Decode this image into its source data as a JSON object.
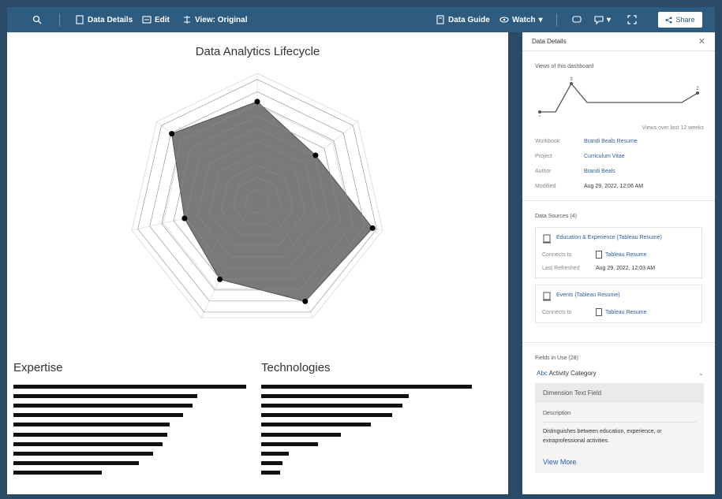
{
  "toolbar": {
    "data_details": "Data Details",
    "edit": "Edit",
    "view_original": "View: Original",
    "data_guide": "Data Guide",
    "watch": "Watch",
    "share": "Share"
  },
  "canvas": {
    "expertise_title": "Expertise",
    "technologies_title": "Technologies"
  },
  "chart_data": [
    {
      "type": "radar",
      "title": "Data Analytics Lifecycle",
      "axes": 7,
      "rings": 4,
      "values": [
        0.78,
        0.58,
        0.92,
        0.86,
        0.67,
        0.58,
        0.85
      ],
      "fill": "#7a7a7a",
      "point_color": "#000000"
    },
    {
      "type": "bar",
      "orientation": "horizontal",
      "title": "Expertise",
      "values": [
        100,
        79,
        77,
        73,
        67,
        66,
        64,
        60,
        54,
        38
      ]
    },
    {
      "type": "bar",
      "orientation": "horizontal",
      "title": "Technologies",
      "values": [
        100,
        70,
        67,
        62,
        52,
        38,
        27,
        13,
        10,
        9
      ]
    }
  ],
  "panel": {
    "title": "Data Details",
    "views_label": "Views of this dashboard",
    "views_chart": [
      0,
      0,
      3,
      1,
      1,
      1,
      1,
      1,
      1,
      1,
      2
    ],
    "views_caption": "Views over last 12 weeks",
    "meta": [
      {
        "k": "Workbook",
        "v": "Brandi Beals Resume",
        "link": true
      },
      {
        "k": "Project",
        "v": "Curriculum Vitae",
        "link": true
      },
      {
        "k": "Author",
        "v": "Brandi Beals",
        "link": true
      },
      {
        "k": "Modified",
        "v": "Aug 29, 2022, 12:06 AM",
        "link": false
      }
    ],
    "sources_label": "Data Sources (4)",
    "source1": {
      "title": "Education & Experience (Tableau Resume)",
      "connects_k": "Connects to",
      "connects_v": "Tableau Resume",
      "refreshed_k": "Last Refreshed",
      "refreshed_v": "Aug 29, 2022, 12:03 AM"
    },
    "source2": {
      "title": "Events (Tableau Resume)",
      "connects_k": "Connects to",
      "connects_v": "Tableau Resume"
    },
    "fields_label": "Fields in Use (28)",
    "field_name": "Activity Category",
    "field_type": "Dimension Text Field",
    "desc_label": "Description",
    "desc_text": "Distinguishes between education, experience, or extraprofessional activities.",
    "view_more": "View More"
  },
  "colors": {
    "frame": "#2b4a66",
    "toolbar": "#2e5c80",
    "link": "#2a5fa3"
  }
}
